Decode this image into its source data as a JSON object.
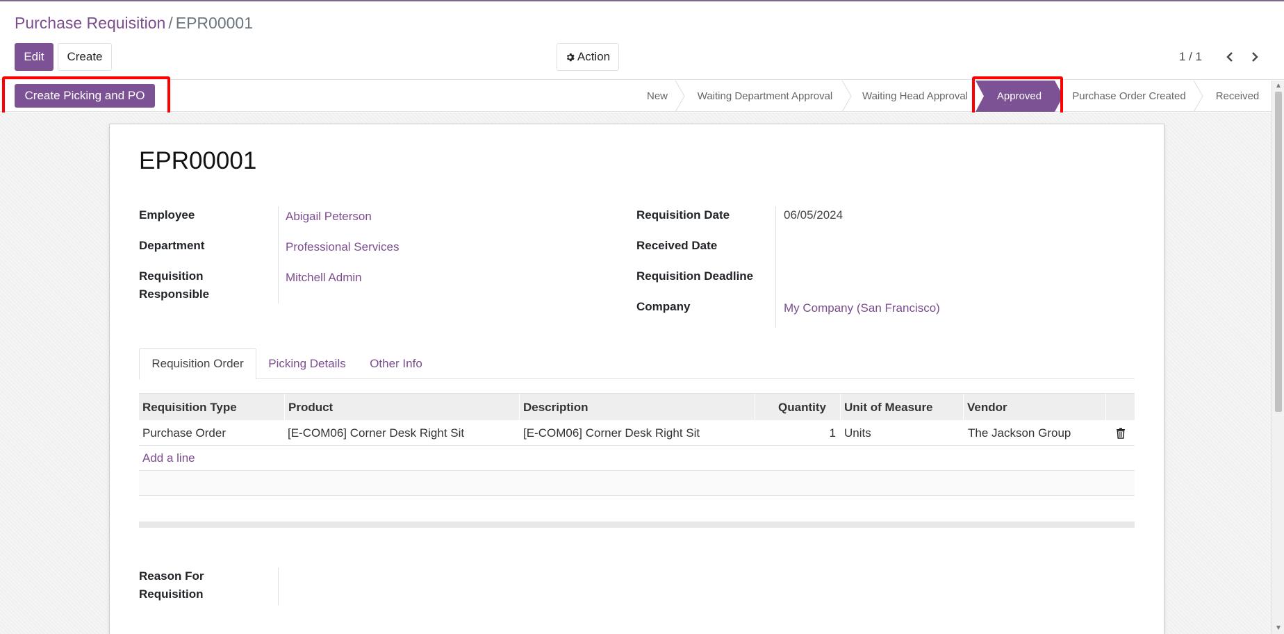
{
  "breadcrumb": {
    "parent": "Purchase Requisition",
    "separator": "/",
    "current": "EPR00001"
  },
  "toolbar": {
    "edit_label": "Edit",
    "create_label": "Create",
    "action_label": "Action",
    "action_icon": "gear-icon"
  },
  "pager": {
    "value": "1 / 1",
    "prev_icon": "chevron-left-icon",
    "next_icon": "chevron-right-icon"
  },
  "header": {
    "button_label": "Create Picking and PO",
    "stages": [
      "New",
      "Waiting Department Approval",
      "Waiting Head Approval",
      "Approved",
      "Purchase Order Created",
      "Received"
    ],
    "active_stage": "Approved"
  },
  "record": {
    "title": "EPR00001",
    "left_fields": [
      {
        "label": "Employee",
        "value": "Abigail Peterson"
      },
      {
        "label": "Department",
        "value": "Professional Services"
      },
      {
        "label_line1": "Requisition",
        "label_line2": "Responsible",
        "value": "Mitchell Admin"
      }
    ],
    "right_fields": [
      {
        "label": "Requisition Date",
        "value": "06/05/2024"
      },
      {
        "label": "Received Date",
        "value": ""
      },
      {
        "label": "Requisition Deadline",
        "value": ""
      },
      {
        "label": "Company",
        "value": "My Company (San Francisco)"
      }
    ]
  },
  "tabs": [
    "Requisition Order",
    "Picking Details",
    "Other Info"
  ],
  "table": {
    "columns": [
      "Requisition Type",
      "Product",
      "Description",
      "Quantity",
      "Unit of Measure",
      "Vendor"
    ],
    "rows": [
      {
        "type": "Purchase Order",
        "product": "[E-COM06] Corner Desk Right Sit",
        "description": "[E-COM06] Corner Desk Right Sit",
        "quantity": "1",
        "uom": "Units",
        "vendor": "The Jackson Group",
        "delete_icon": "trash-icon"
      }
    ],
    "add_line": "Add a line"
  },
  "reason": {
    "label_line1": "Reason For",
    "label_line2": "Requisition",
    "value": ""
  },
  "colors": {
    "primary": "#7c5295",
    "link": "#7c4d8e",
    "highlight": "#ff0000"
  }
}
